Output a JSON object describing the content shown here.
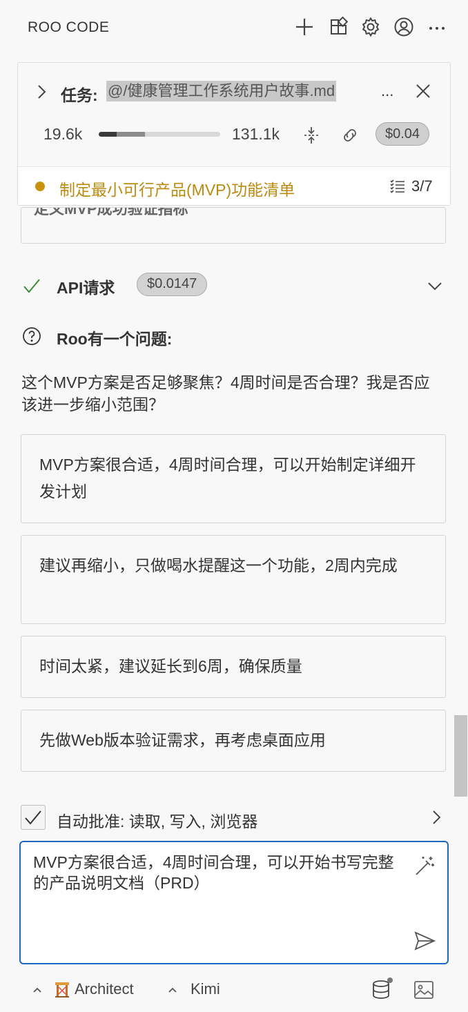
{
  "header": {
    "title": "ROO CODE",
    "icons": [
      "plus-icon",
      "marketplace-icon",
      "gear-icon",
      "account-icon",
      "more-icon"
    ]
  },
  "task": {
    "label": "任务:",
    "mention": "@/健康管理工作系统用户故事.md",
    "ellipsis": "...",
    "tokens_in": "19.6k",
    "tokens_max": "131.1k",
    "context_progress": 0.15,
    "context_reserved": 0.38,
    "cost": "$0.04",
    "todo_text": "制定最小可行产品(MVP)功能清单",
    "todo_count": "3/7",
    "todo_color": "#c8920e"
  },
  "hidden_line": "定义MVP成功验证指标",
  "api": {
    "label": "API请求",
    "cost": "$0.0147",
    "check_color": "#388a34"
  },
  "question_header": "Roo有一个问题:",
  "question_text": "这个MVP方案是否足够聚焦？4周时间是否合理？我是否应该进一步缩小范围？",
  "options": [
    "MVP方案很合适，4周时间合理，可以开始制定详细开发计划",
    "建议再缩小，只做喝水提醒这一个功能，2周内完成",
    "时间太紧，建议延长到6周，确保质量",
    "先做Web版本验证需求，再考虑桌面应用"
  ],
  "auto_approve": {
    "checked": true,
    "label": "自动批准: 读取, 写入, 浏览器"
  },
  "input": {
    "value": "MVP方案很合适，4周时间合理，可以开始书写完整的产品说明文档（PRD）",
    "focus_color": "#1f66c4"
  },
  "footer": {
    "mode": "Architect",
    "model": "Kimi"
  }
}
